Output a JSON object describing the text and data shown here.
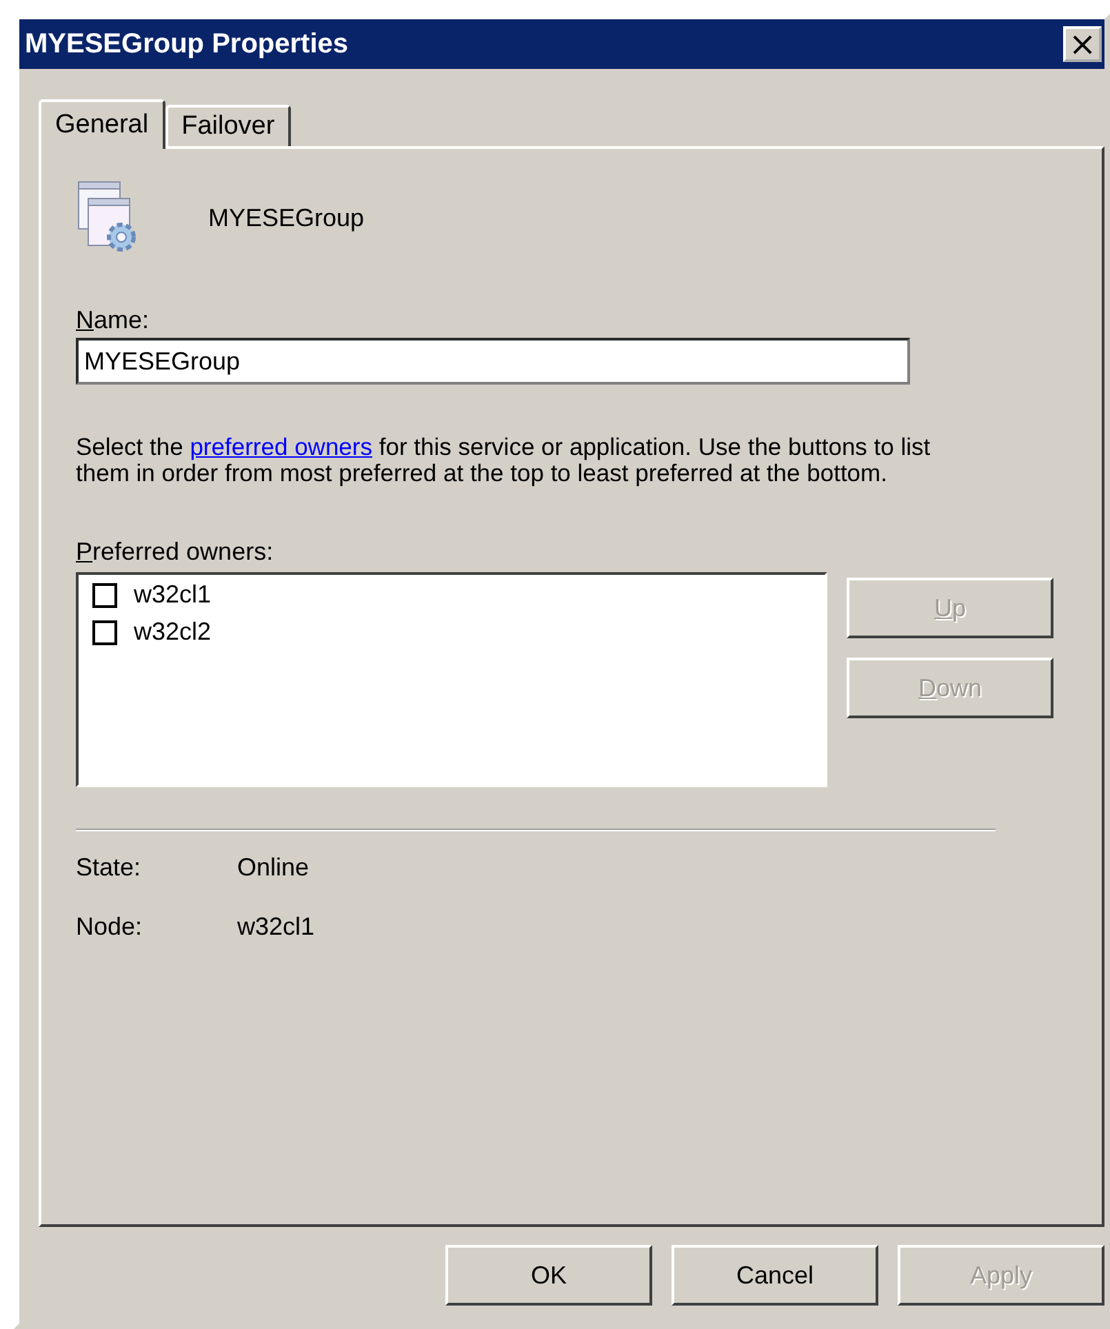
{
  "window": {
    "title": "MYESEGroup Properties",
    "close": "×"
  },
  "tabs": [
    {
      "label": "General",
      "selected": true
    },
    {
      "label": "Failover",
      "selected": false
    }
  ],
  "group_name": "MYESEGroup",
  "name_field": {
    "label": "Name:",
    "value": "MYESEGroup"
  },
  "description": {
    "before": "Select the ",
    "link": "preferred owners",
    "after": " for this service or application. Use the buttons to list them in order from most preferred at the top to least preferred at the bottom."
  },
  "owners": {
    "label": "Preferred owners:",
    "items": [
      {
        "name": "w32cl1",
        "checked": false
      },
      {
        "name": "w32cl2",
        "checked": false
      }
    ]
  },
  "order_buttons": [
    {
      "label": "Up",
      "disabled": true
    },
    {
      "label": "Down",
      "disabled": true
    }
  ],
  "info": [
    {
      "label": "State:",
      "value": "Online"
    },
    {
      "label": "Node:",
      "value": "w32cl1"
    }
  ],
  "buttons": [
    {
      "label": "OK",
      "disabled": false
    },
    {
      "label": "Cancel",
      "disabled": false
    },
    {
      "label": "Apply",
      "disabled": true
    }
  ]
}
